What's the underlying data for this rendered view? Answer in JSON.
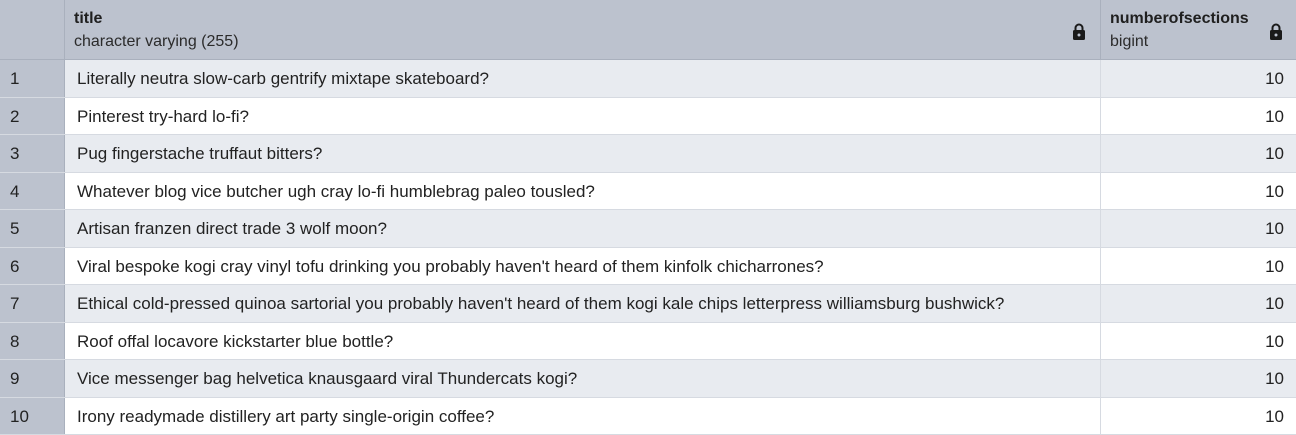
{
  "columns": [
    {
      "name": "title",
      "type": "character varying (255)",
      "locked": true
    },
    {
      "name": "numberofsections",
      "type": "bigint",
      "locked": true
    }
  ],
  "rows": [
    {
      "n": "1",
      "title": "Literally neutra slow-carb gentrify mixtape skateboard?",
      "sections": "10"
    },
    {
      "n": "2",
      "title": "Pinterest try-hard lo-fi?",
      "sections": "10"
    },
    {
      "n": "3",
      "title": "Pug fingerstache truffaut bitters?",
      "sections": "10"
    },
    {
      "n": "4",
      "title": "Whatever blog vice butcher ugh cray lo-fi humblebrag paleo tousled?",
      "sections": "10"
    },
    {
      "n": "5",
      "title": "Artisan franzen direct trade 3 wolf moon?",
      "sections": "10"
    },
    {
      "n": "6",
      "title": "Viral bespoke kogi cray vinyl tofu drinking you probably haven't heard of them kinfolk chicharrones?",
      "sections": "10"
    },
    {
      "n": "7",
      "title": "Ethical cold-pressed quinoa sartorial you probably haven't heard of them kogi kale chips letterpress williamsburg bushwick?",
      "sections": "10"
    },
    {
      "n": "8",
      "title": "Roof offal locavore kickstarter blue bottle?",
      "sections": "10"
    },
    {
      "n": "9",
      "title": "Vice messenger bag helvetica knausgaard viral Thundercats kogi?",
      "sections": "10"
    },
    {
      "n": "10",
      "title": "Irony readymade distillery art party single-origin coffee?",
      "sections": "10"
    }
  ],
  "icons": {
    "locked": "lock-icon"
  }
}
